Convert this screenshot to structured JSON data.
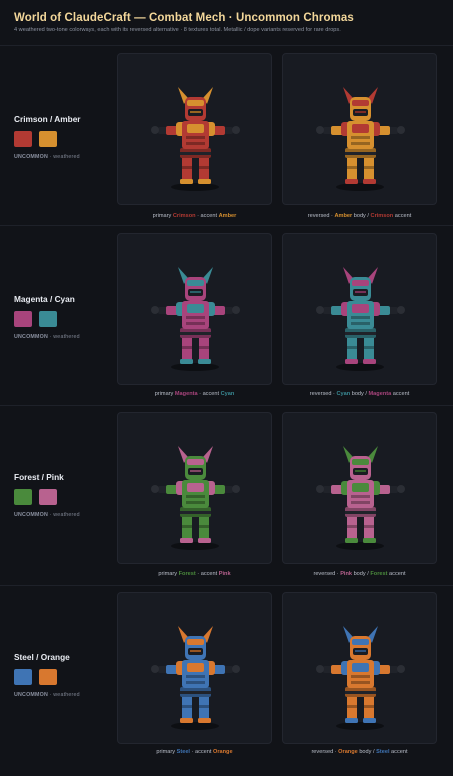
{
  "header": {
    "title": "World of ClaudeCraft — Combat Mech · Uncommon Chromas",
    "subtitle": "4 weathered two-tone colorways, each with its reversed alternative · 8 textures total. Metallic / dope variants reserved for rare drops."
  },
  "chromas": [
    {
      "name": "Crimson / Amber",
      "rarity": "UNCOMMON",
      "tag": "weathered",
      "color_a": "#b23a33",
      "color_b": "#d6902f",
      "primary_caption": {
        "pre": "primary ",
        "a": "Crimson",
        "mid": " · accent ",
        "b": "Amber",
        "post": ""
      },
      "reversed_caption": {
        "pre": "reversed · ",
        "a": "Amber",
        "mid": " body / ",
        "b": "Crimson",
        "post": " accent"
      }
    },
    {
      "name": "Magenta / Cyan",
      "rarity": "UNCOMMON",
      "tag": "weathered",
      "color_a": "#a8447c",
      "color_b": "#3a8b95",
      "primary_caption": {
        "pre": "primary ",
        "a": "Magenta",
        "mid": " · accent ",
        "b": "Cyan",
        "post": ""
      },
      "reversed_caption": {
        "pre": "reversed · ",
        "a": "Cyan",
        "mid": " body / ",
        "b": "Magenta",
        "post": " accent"
      }
    },
    {
      "name": "Forest / Pink",
      "rarity": "UNCOMMON",
      "tag": "weathered",
      "color_a": "#4a8a3c",
      "color_b": "#b8628f",
      "primary_caption": {
        "pre": "primary ",
        "a": "Forest",
        "mid": " · accent ",
        "b": "Pink",
        "post": ""
      },
      "reversed_caption": {
        "pre": "reversed · ",
        "a": "Pink",
        "mid": " body / ",
        "b": "Forest",
        "post": " accent"
      }
    },
    {
      "name": "Steel / Orange",
      "rarity": "UNCOMMON",
      "tag": "weathered",
      "color_a": "#3f74b4",
      "color_b": "#d8782f",
      "primary_caption": {
        "pre": "primary ",
        "a": "Steel",
        "mid": " · accent ",
        "b": "Orange",
        "post": ""
      },
      "reversed_caption": {
        "pre": "reversed · ",
        "a": "Orange",
        "mid": " body / ",
        "b": "Steel",
        "post": " accent"
      }
    }
  ]
}
